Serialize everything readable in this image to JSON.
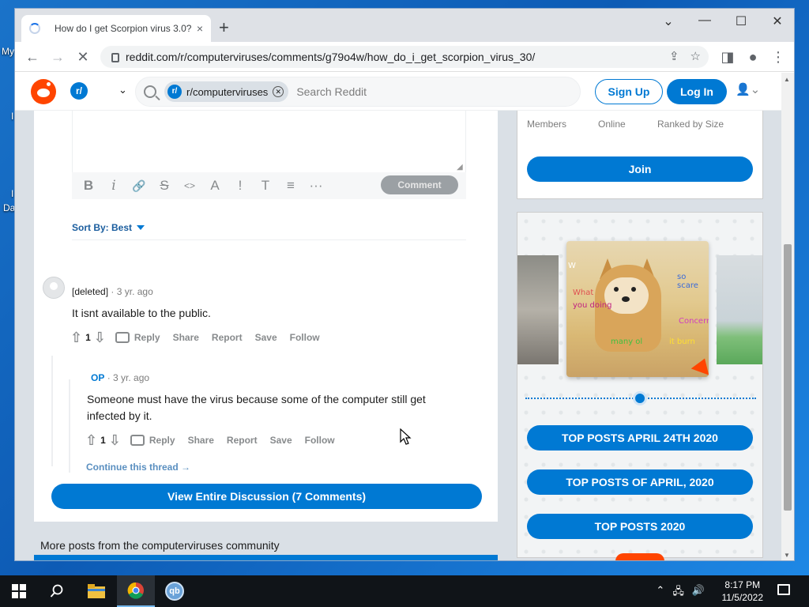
{
  "desktop": {
    "labels": [
      "My",
      "I",
      "I",
      "Da"
    ]
  },
  "browser": {
    "tab_title": "How do I get Scorpion virus 3.0?",
    "tab_close": "×",
    "new_tab": "+",
    "min": "⌄",
    "restore": "☐",
    "close": "✕",
    "url": "reddit.com/r/computerviruses/comments/g79o4w/how_do_i_get_scorpion_virus_30/"
  },
  "header": {
    "community_badge": "r/",
    "chip_badge": "r/",
    "chip_label": "r/computerviruses",
    "search_placeholder": "Search Reddit",
    "sign_up": "Sign Up",
    "log_in": "Log In"
  },
  "editor": {
    "tools": [
      "B",
      "i",
      "🔗",
      "S",
      "<>",
      "A",
      "!",
      "T",
      "≡",
      "···"
    ],
    "comment_button": "Comment"
  },
  "sort": {
    "label": "Sort By: Best"
  },
  "comments": [
    {
      "author": "[deleted]",
      "time": "3 yr. ago",
      "text": "It isnt available to the public.",
      "votes": "1",
      "actions": [
        "Reply",
        "Share",
        "Report",
        "Save",
        "Follow"
      ]
    },
    {
      "author": "OP",
      "time": "3 yr. ago",
      "text": "Someone must have the virus because some of the computer still get infected by it.",
      "votes": "1",
      "actions": [
        "Reply",
        "Share",
        "Report",
        "Save",
        "Follow"
      ]
    }
  ],
  "thread": {
    "continue": "Continue this thread →",
    "view_all": "View Entire Discussion (7 Comments)",
    "more_posts": "More posts from the computerviruses community"
  },
  "sidebar": {
    "stats": [
      "Members",
      "Online",
      "Ranked by Size"
    ],
    "join": "Join",
    "meme_words": [
      "W",
      "What",
      "you doing",
      "so scare",
      "Concern",
      "many ol",
      "it burn"
    ],
    "top_buttons": [
      "TOP POSTS APRIL 24TH 2020",
      "TOP POSTS OF APRIL, 2020",
      "TOP POSTS 2020"
    ]
  },
  "taskbar": {
    "time": "8:17 PM",
    "date": "11/5/2022",
    "qb_label": "qb"
  }
}
